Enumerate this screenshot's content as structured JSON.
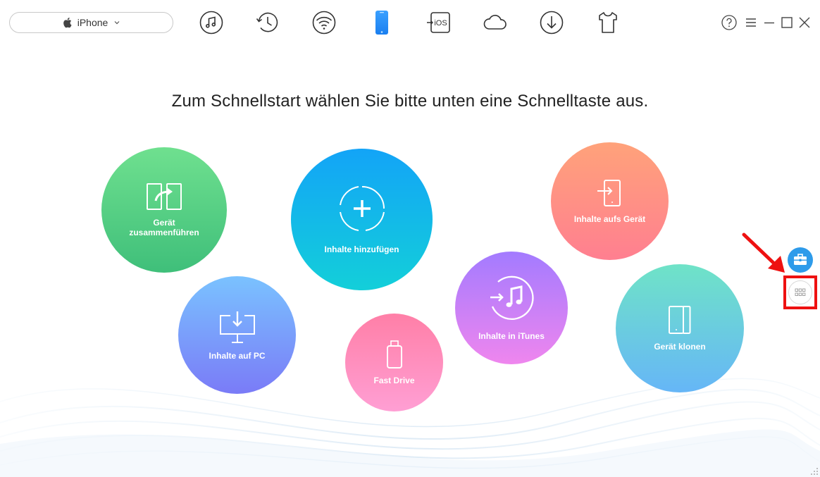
{
  "toolbar": {
    "device_label": "iPhone",
    "device_icon": "apple-icon",
    "nav": [
      {
        "name": "music-icon"
      },
      {
        "name": "history-icon"
      },
      {
        "name": "wifi-icon"
      },
      {
        "name": "phone-icon",
        "active": true
      },
      {
        "name": "ios-transfer-icon",
        "text": "iOS"
      },
      {
        "name": "cloud-icon"
      },
      {
        "name": "download-icon"
      },
      {
        "name": "tshirt-icon"
      }
    ],
    "window": [
      "help-icon",
      "menu-icon",
      "minimize-icon",
      "maximize-icon",
      "close-icon"
    ]
  },
  "headline": "Zum Schnellstart wählen Sie bitte unten eine Schnelltaste aus.",
  "quick_actions": {
    "merge": {
      "label_line1": "Gerät",
      "label_line2": "zusammenführen",
      "color_top": "#6fe08f",
      "color_bottom": "#3fbf7a"
    },
    "add": {
      "label": "Inhalte hinzufügen",
      "color_top": "#13a4f7",
      "color_bottom": "#13cfd9"
    },
    "to_device": {
      "label": "Inhalte aufs Gerät",
      "color_top": "#ffa27a",
      "color_bottom": "#ff7f90"
    },
    "to_pc": {
      "label": "Inhalte auf PC",
      "color_top": "#7ac2ff",
      "color_bottom": "#7a7bf7"
    },
    "fast_drive": {
      "label": "Fast Drive",
      "color_top": "#ff7fa7",
      "color_bottom": "#ff9fd4"
    },
    "to_itunes": {
      "label": "Inhalte in iTunes",
      "color_top": "#a37bff",
      "color_bottom": "#ef86ee"
    },
    "clone": {
      "label": "Gerät klonen",
      "color_top": "#6fe3c7",
      "color_bottom": "#66b6f7"
    }
  },
  "side": {
    "toolbox_icon": "toolbox-icon",
    "grid_icon": "grid-icon",
    "highlight_color": "#ee1111",
    "toolbox_color": "#2e9bea"
  }
}
